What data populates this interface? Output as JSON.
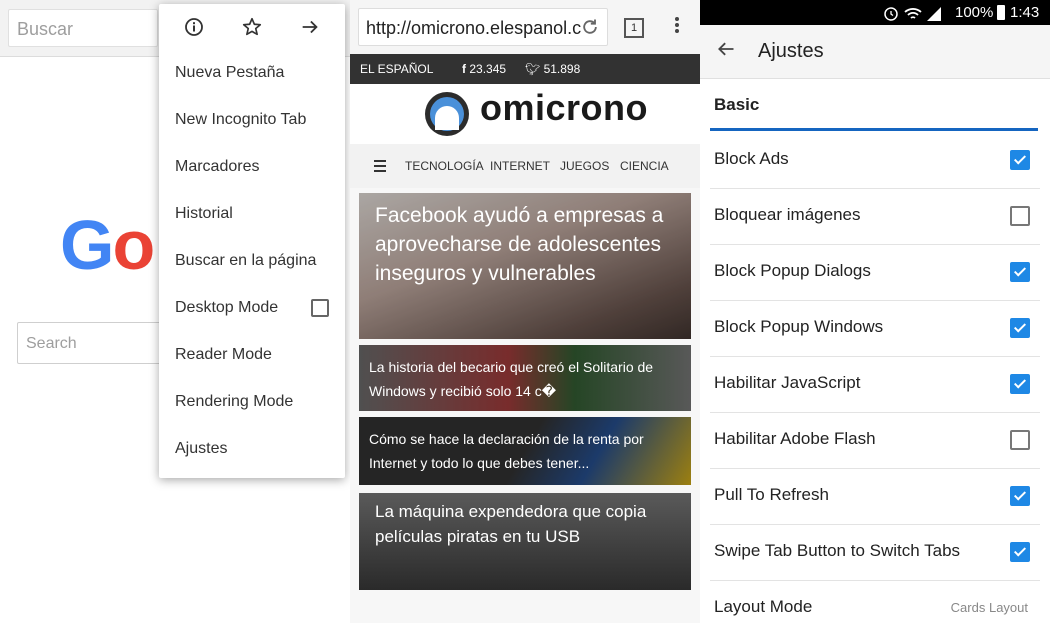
{
  "panel1": {
    "search_placeholder": "Buscar",
    "logo_text": "Go",
    "search2_placeholder": "Search",
    "menu": {
      "icons": [
        "info-icon",
        "star-icon",
        "forward-arrow-icon"
      ],
      "items": [
        {
          "label": "Nueva Pestaña"
        },
        {
          "label": "New Incognito Tab"
        },
        {
          "label": "Marcadores"
        },
        {
          "label": "Historial"
        },
        {
          "label": "Buscar en la página"
        },
        {
          "label": "Desktop Mode",
          "checkbox": false
        },
        {
          "label": "Reader Mode"
        },
        {
          "label": "Rendering Mode"
        },
        {
          "label": "Ajustes"
        }
      ]
    }
  },
  "panel2": {
    "url": "http://omicrono.elespanol.c",
    "tab_count": "1",
    "brand": "EL ESPAÑOL",
    "facebook_count": "23.345",
    "twitter_count": "51.898",
    "site_name": "omicrono",
    "nav": [
      "TECNOLOGÍA",
      "INTERNET",
      "JUEGOS",
      "CIENCIA"
    ],
    "articles": [
      "Facebook ayudó a empresas a aprovecharse de adolescentes inseguros y vulnerables",
      "La historia del becario que creó el Solitario de Windows y recibió solo 14 c�",
      "Cómo se hace la declaración de la renta por Internet y todo lo que debes tener...",
      "La máquina expendedora que copia películas piratas en tu USB"
    ]
  },
  "panel3": {
    "status": {
      "battery": "100%",
      "time": "1:43"
    },
    "title": "Ajustes",
    "section": "Basic",
    "settings": [
      {
        "label": "Block Ads",
        "checked": true
      },
      {
        "label": "Bloquear imágenes",
        "checked": false
      },
      {
        "label": "Block Popup Dialogs",
        "checked": true
      },
      {
        "label": "Block Popup Windows",
        "checked": true
      },
      {
        "label": "Habilitar JavaScript",
        "checked": true
      },
      {
        "label": "Habilitar Adobe Flash",
        "checked": false
      },
      {
        "label": "Pull To Refresh",
        "checked": true
      },
      {
        "label": "Swipe Tab Button to Switch Tabs",
        "checked": true
      },
      {
        "label": "Layout Mode",
        "value": "Cards Layout"
      }
    ]
  }
}
